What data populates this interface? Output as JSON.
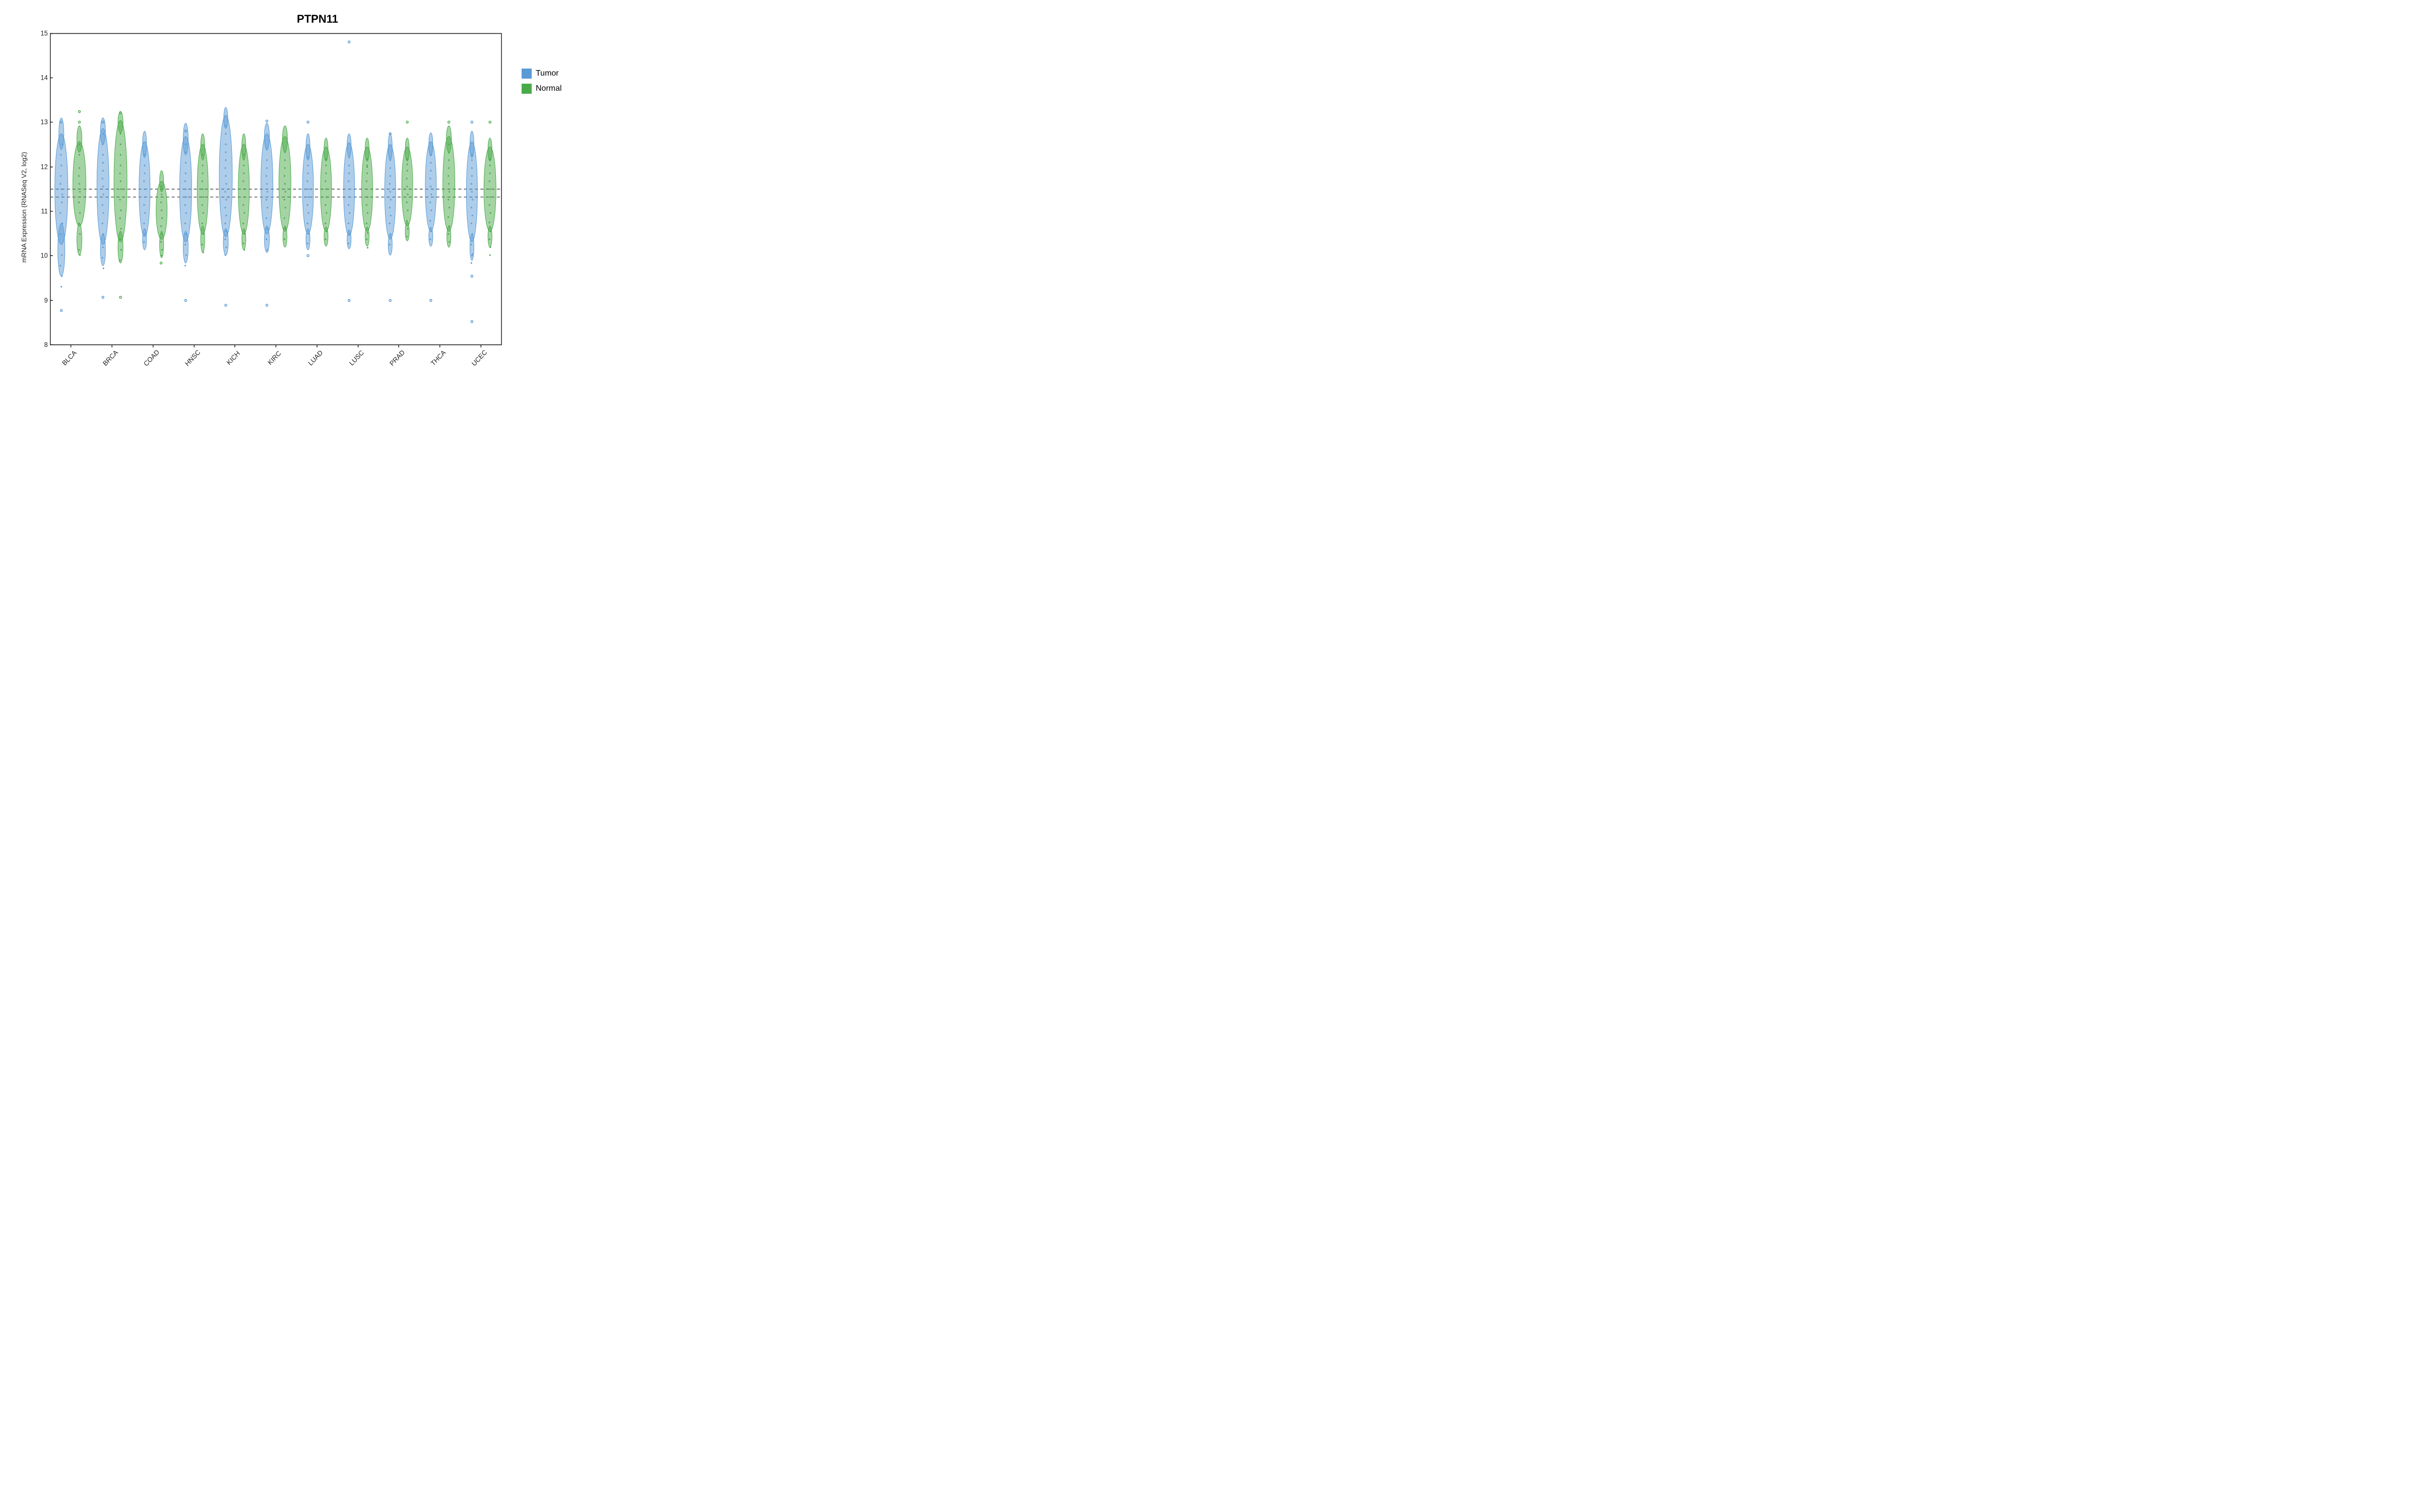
{
  "title": "PTPN11",
  "yAxisLabel": "mRNA Expression (RNASeq V2, log2)",
  "yTicks": [
    8,
    9,
    10,
    11,
    12,
    13,
    14,
    15
  ],
  "xLabels": [
    "BLCA",
    "BRCA",
    "COAD",
    "HNSC",
    "KICH",
    "KIRC",
    "LUAD",
    "LUSC",
    "PRAD",
    "THCA",
    "UCEC"
  ],
  "legend": {
    "items": [
      {
        "label": "Tumor",
        "color": "#4a90d9"
      },
      {
        "label": "Normal",
        "color": "#4aaa4a"
      }
    ]
  },
  "colors": {
    "tumor": "#5b9bd5",
    "normal": "#4aaa4a",
    "border": "#222222",
    "dottedLine": "#555555"
  },
  "dottedLines": [
    11.5,
    11.35
  ]
}
